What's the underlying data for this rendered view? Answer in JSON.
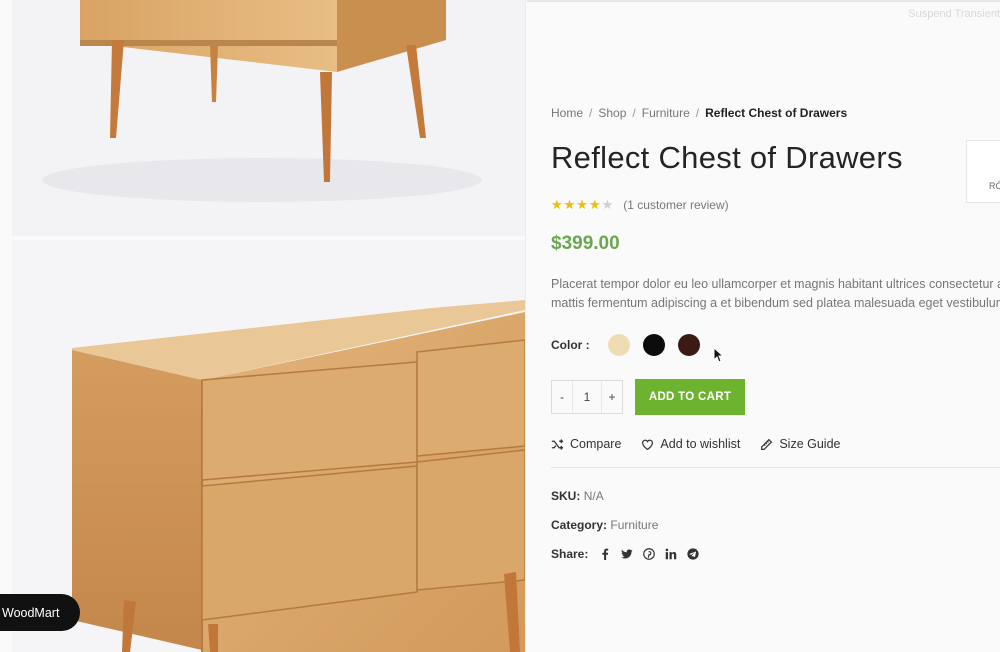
{
  "breadcrumb": [
    "Home",
    "Shop",
    "Furniture",
    "Reflect Chest of Drawers"
  ],
  "product": {
    "title": "Reflect Chest of Drawers",
    "rating": 4,
    "rating_max": 5,
    "review_text": "(1 customer review)",
    "price": "$399.00",
    "description_line1": "Placerat tempor dolor eu leo ullamcorper et magnis habitant ultrices consectetur arcu",
    "description_line2": "mattis fermentum adipiscing a et bibendum sed platea malesuada eget vestibulum."
  },
  "color": {
    "label": "Color :",
    "swatches": [
      "#f0dcb4",
      "#0c0c0c",
      "#3a1a12"
    ]
  },
  "cart": {
    "minus": "-",
    "quantity": "1",
    "plus": "+",
    "add_label": "ADD TO CART",
    "accent": "#6db32f"
  },
  "actions": {
    "compare": "Compare",
    "wishlist": "Add to wishlist",
    "size_guide": "Size Guide"
  },
  "meta": {
    "sku_label": "SKU:",
    "sku_value": "N/A",
    "category_label": "Category:",
    "category_value": "Furniture",
    "share_label": "Share:",
    "share_icons": [
      "facebook-icon",
      "twitter-icon",
      "pinterest-icon",
      "linkedin-icon",
      "telegram-icon"
    ]
  },
  "overlay": {
    "suspend_text": "Suspend Transient",
    "side_box_text": "RÓ",
    "brand_pill": "WoodMart"
  },
  "colors": {
    "price": "#6aa84f",
    "star": "#eabe12"
  }
}
